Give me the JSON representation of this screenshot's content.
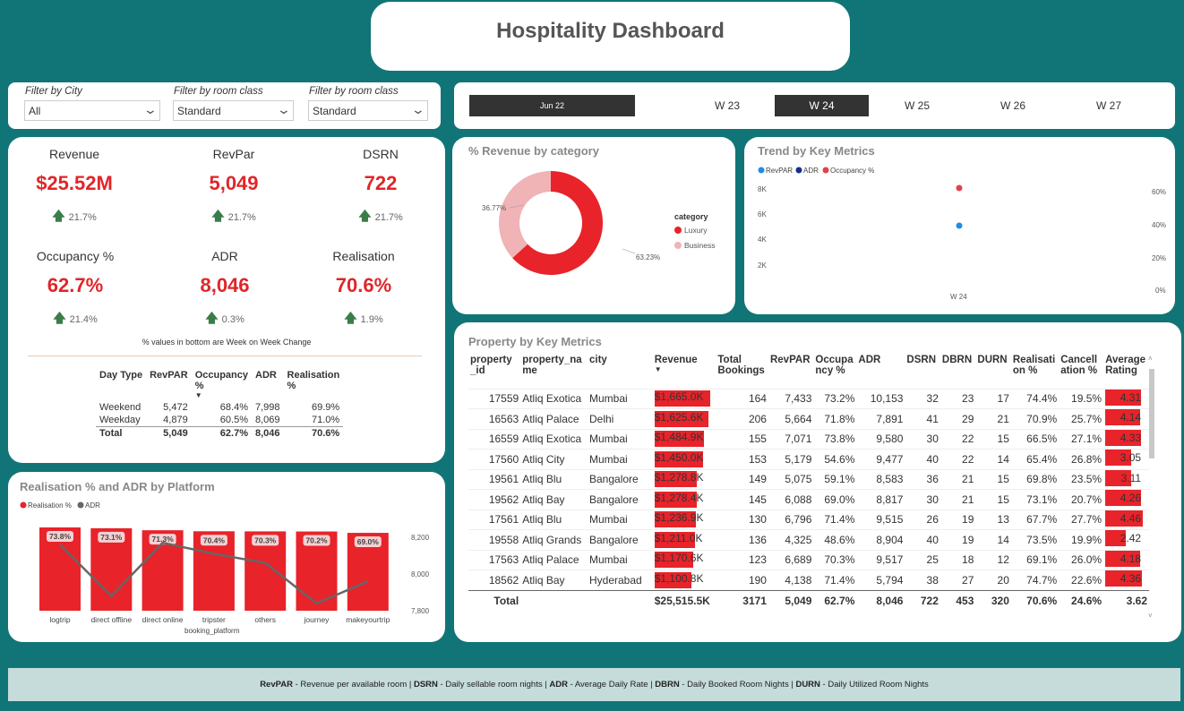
{
  "title": "Hospitality Dashboard",
  "filters": [
    {
      "label": "Filter by City",
      "value": "All"
    },
    {
      "label": "Filter by room class",
      "value": "Standard"
    },
    {
      "label": "Filter by room class",
      "value": "Standard"
    }
  ],
  "weeks": {
    "date": "Jun 22",
    "items": [
      "W 23",
      "W 24",
      "W 25",
      "W 26",
      "W 27"
    ],
    "selected": "W 24"
  },
  "kpis": [
    {
      "label": "Revenue",
      "value": "$25.52M",
      "change": "21.7%"
    },
    {
      "label": "RevPar",
      "value": "5,049",
      "change": "21.7%"
    },
    {
      "label": "DSRN",
      "value": "722",
      "change": "21.7%"
    },
    {
      "label": "Occupancy %",
      "value": "62.7%",
      "change": "21.4%"
    },
    {
      "label": "ADR",
      "value": "8,046",
      "change": "0.3%"
    },
    {
      "label": "Realisation",
      "value": "70.6%",
      "change": "1.9%"
    }
  ],
  "kpi_note": "% values in bottom are Week on Week Change",
  "day_table": {
    "headers": [
      "Day Type",
      "RevPAR",
      "Occupancy %",
      "ADR",
      "Realisation %"
    ],
    "rows": [
      [
        "Weekend",
        "5,472",
        "68.4%",
        "7,998",
        "69.9%"
      ],
      [
        "Weekday",
        "4,879",
        "60.5%",
        "8,069",
        "71.0%"
      ]
    ],
    "total": [
      "Total",
      "5,049",
      "62.7%",
      "8,046",
      "70.6%"
    ]
  },
  "revenue_by_category": {
    "title": "% Revenue by category",
    "legend_title": "category",
    "slices": [
      {
        "name": "Luxury",
        "value": 63.23,
        "label": "63.23%",
        "color": "#e8232a"
      },
      {
        "name": "Business",
        "value": 36.77,
        "label": "36.77%",
        "color": "#f0b3b6"
      }
    ]
  },
  "trend": {
    "title": "Trend by Key Metrics",
    "legend": [
      {
        "name": "RevPAR",
        "color": "#1f8ce6"
      },
      {
        "name": "ADR",
        "color": "#14308c"
      },
      {
        "name": "Occupancy %",
        "color": "#e0434b"
      }
    ],
    "left_ticks": [
      "8K",
      "6K",
      "4K",
      "2K"
    ],
    "right_ticks": [
      "60%",
      "40%",
      "20%",
      "0%"
    ],
    "x_label": "W 24"
  },
  "platform": {
    "title": "Realisation % and ADR by Platform",
    "legend": [
      {
        "name": "Realisation %",
        "color": "#e8232a"
      },
      {
        "name": "ADR",
        "color": "#666666"
      }
    ],
    "x_axis_title": "booking_platform",
    "right_ticks": [
      "8,200",
      "8,000",
      "7,800"
    ]
  },
  "chart_data": [
    {
      "type": "pie",
      "title": "% Revenue by category",
      "categories": [
        "Luxury",
        "Business"
      ],
      "values": [
        63.23,
        36.77
      ]
    },
    {
      "type": "scatter",
      "title": "Trend by Key Metrics",
      "x": [
        "W 24"
      ],
      "series": [
        {
          "name": "RevPAR",
          "values": [
            5049
          ]
        },
        {
          "name": "ADR",
          "values": [
            8046
          ]
        },
        {
          "name": "Occupancy %",
          "values": [
            62.7
          ]
        }
      ],
      "ylim_left": [
        0,
        8000
      ],
      "ylim_right": [
        0,
        60
      ]
    },
    {
      "type": "bar",
      "title": "Realisation % and ADR by Platform",
      "xlabel": "booking_platform",
      "categories": [
        "logtrip",
        "direct offline",
        "direct online",
        "tripster",
        "others",
        "journey",
        "makeyourtrip"
      ],
      "series": [
        {
          "name": "Realisation %",
          "values": [
            73.8,
            73.1,
            71.3,
            70.4,
            70.3,
            70.2,
            69.0
          ],
          "labels": [
            "73.8%",
            "73.1%",
            "71.3%",
            "70.4%",
            "70.3%",
            "70.2%",
            "69.0%"
          ]
        },
        {
          "name": "ADR",
          "values": [
            8160,
            7880,
            8170,
            8110,
            8060,
            7840,
            7960
          ]
        }
      ],
      "ylim_right": [
        7800,
        8200
      ]
    }
  ],
  "property_table": {
    "title": "Property by Key Metrics",
    "headers": [
      "property\n_id",
      "property_na\nme",
      "city",
      "Revenue",
      "Total\nBookings",
      "RevPAR",
      "Occupa\nncy %",
      "ADR",
      "DSRN",
      "DBRN",
      "DURN",
      "Realisati\non %",
      "Cancell\nation %",
      "Average\nRating"
    ],
    "rows": [
      {
        "id": "17559",
        "name": "Atliq Exotica",
        "city": "Mumbai",
        "revenue": "$1,665.0K",
        "rev": 1665.0,
        "bookings": "164",
        "revpar": "7,433",
        "occ": "73.2%",
        "adr": "10,153",
        "dsrn": "32",
        "dbrn": "23",
        "durn": "17",
        "real": "74.4%",
        "canc": "19.5%",
        "rating": "4.31",
        "r": 4.31
      },
      {
        "id": "16563",
        "name": "Atliq Palace",
        "city": "Delhi",
        "revenue": "$1,625.6K",
        "rev": 1625.6,
        "bookings": "206",
        "revpar": "5,664",
        "occ": "71.8%",
        "adr": "7,891",
        "dsrn": "41",
        "dbrn": "29",
        "durn": "21",
        "real": "70.9%",
        "canc": "25.7%",
        "rating": "4.14",
        "r": 4.14
      },
      {
        "id": "16559",
        "name": "Atliq Exotica",
        "city": "Mumbai",
        "revenue": "$1,484.9K",
        "rev": 1484.9,
        "bookings": "155",
        "revpar": "7,071",
        "occ": "73.8%",
        "adr": "9,580",
        "dsrn": "30",
        "dbrn": "22",
        "durn": "15",
        "real": "66.5%",
        "canc": "27.1%",
        "rating": "4.33",
        "r": 4.33
      },
      {
        "id": "17560",
        "name": "Atliq City",
        "city": "Mumbai",
        "revenue": "$1,450.0K",
        "rev": 1450.0,
        "bookings": "153",
        "revpar": "5,179",
        "occ": "54.6%",
        "adr": "9,477",
        "dsrn": "40",
        "dbrn": "22",
        "durn": "14",
        "real": "65.4%",
        "canc": "26.8%",
        "rating": "3.05",
        "r": 3.05
      },
      {
        "id": "19561",
        "name": "Atliq Blu",
        "city": "Bangalore",
        "revenue": "$1,278.8K",
        "rev": 1278.8,
        "bookings": "149",
        "revpar": "5,075",
        "occ": "59.1%",
        "adr": "8,583",
        "dsrn": "36",
        "dbrn": "21",
        "durn": "15",
        "real": "69.8%",
        "canc": "23.5%",
        "rating": "3.11",
        "r": 3.11
      },
      {
        "id": "19562",
        "name": "Atliq Bay",
        "city": "Bangalore",
        "revenue": "$1,278.4K",
        "rev": 1278.4,
        "bookings": "145",
        "revpar": "6,088",
        "occ": "69.0%",
        "adr": "8,817",
        "dsrn": "30",
        "dbrn": "21",
        "durn": "15",
        "real": "73.1%",
        "canc": "20.7%",
        "rating": "4.26",
        "r": 4.26
      },
      {
        "id": "17561",
        "name": "Atliq Blu",
        "city": "Mumbai",
        "revenue": "$1,236.9K",
        "rev": 1236.9,
        "bookings": "130",
        "revpar": "6,796",
        "occ": "71.4%",
        "adr": "9,515",
        "dsrn": "26",
        "dbrn": "19",
        "durn": "13",
        "real": "67.7%",
        "canc": "27.7%",
        "rating": "4.46",
        "r": 4.46
      },
      {
        "id": "19558",
        "name": "Atliq Grands",
        "city": "Bangalore",
        "revenue": "$1,211.0K",
        "rev": 1211.0,
        "bookings": "136",
        "revpar": "4,325",
        "occ": "48.6%",
        "adr": "8,904",
        "dsrn": "40",
        "dbrn": "19",
        "durn": "14",
        "real": "73.5%",
        "canc": "19.9%",
        "rating": "2.42",
        "r": 2.42
      },
      {
        "id": "17563",
        "name": "Atliq Palace",
        "city": "Mumbai",
        "revenue": "$1,170.6K",
        "rev": 1170.6,
        "bookings": "123",
        "revpar": "6,689",
        "occ": "70.3%",
        "adr": "9,517",
        "dsrn": "25",
        "dbrn": "18",
        "durn": "12",
        "real": "69.1%",
        "canc": "26.0%",
        "rating": "4.18",
        "r": 4.18
      },
      {
        "id": "18562",
        "name": "Atliq Bay",
        "city": "Hyderabad",
        "revenue": "$1,100.8K",
        "rev": 1100.8,
        "bookings": "190",
        "revpar": "4,138",
        "occ": "71.4%",
        "adr": "5,794",
        "dsrn": "38",
        "dbrn": "27",
        "durn": "20",
        "real": "74.7%",
        "canc": "22.6%",
        "rating": "4.36",
        "r": 4.36
      }
    ],
    "total": {
      "label": "Total",
      "revenue": "$25,515.5K",
      "bookings": "3171",
      "revpar": "5,049",
      "occ": "62.7%",
      "adr": "8,046",
      "dsrn": "722",
      "dbrn": "453",
      "durn": "320",
      "real": "70.6%",
      "canc": "24.6%",
      "rating": "3.62"
    }
  },
  "footer": [
    {
      "k": "RevPAR",
      "v": " - Revenue per available room | "
    },
    {
      "k": "DSRN",
      "v": " - Daily sellable room nights | "
    },
    {
      "k": "ADR",
      "v": " - Average Daily Rate | "
    },
    {
      "k": "DBRN",
      "v": " - Daily Booked Room Nights | "
    },
    {
      "k": "DURN",
      "v": " - Daily Utilized Room Nights"
    }
  ]
}
